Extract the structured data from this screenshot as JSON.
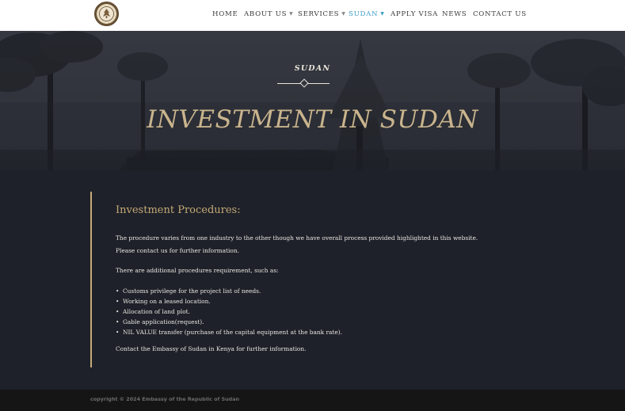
{
  "header": {
    "logo_icon": "embassy-seal-icon",
    "nav": [
      {
        "label": "HOME",
        "dropdown": false,
        "active": false
      },
      {
        "label": "ABOUT US",
        "dropdown": true,
        "active": false
      },
      {
        "label": "SERVICES",
        "dropdown": true,
        "active": false
      },
      {
        "label": "SUDAN",
        "dropdown": true,
        "active": true
      },
      {
        "label": "APPLY VISA",
        "dropdown": false,
        "active": false
      },
      {
        "label": "NEWS",
        "dropdown": false,
        "active": false
      },
      {
        "label": "CONTACT US",
        "dropdown": false,
        "active": false
      }
    ],
    "caret_icon": "chevron-down-icon",
    "active_color": "#3f9fc6"
  },
  "hero": {
    "kicker": "SUDAN",
    "title": "INVESTMENT IN SUDAN",
    "title_color": "#c9b48d"
  },
  "content": {
    "heading": "Investment Procedures:",
    "intro_line1": "The procedure varies from one industry to the other though we have overall process provided highlighted in this website.",
    "intro_line2": "Please contact us for further information.",
    "additional": "There are additional procedures requirement, such as:",
    "requirements": [
      "Customs privilege for the project list of needs.",
      "Working on a leased location.",
      "Allocation of land plot.",
      "Gable application(request).",
      "NIL VALUE transfer (purchase of the capital equipment at the bank rate)."
    ],
    "contact": "Contact the Embassy of Sudan in Kenya for further information.",
    "accent_color": "#c5a977"
  },
  "footer": {
    "copyright": "copyright © 2024 Embassy of the Republic of Sudan"
  }
}
